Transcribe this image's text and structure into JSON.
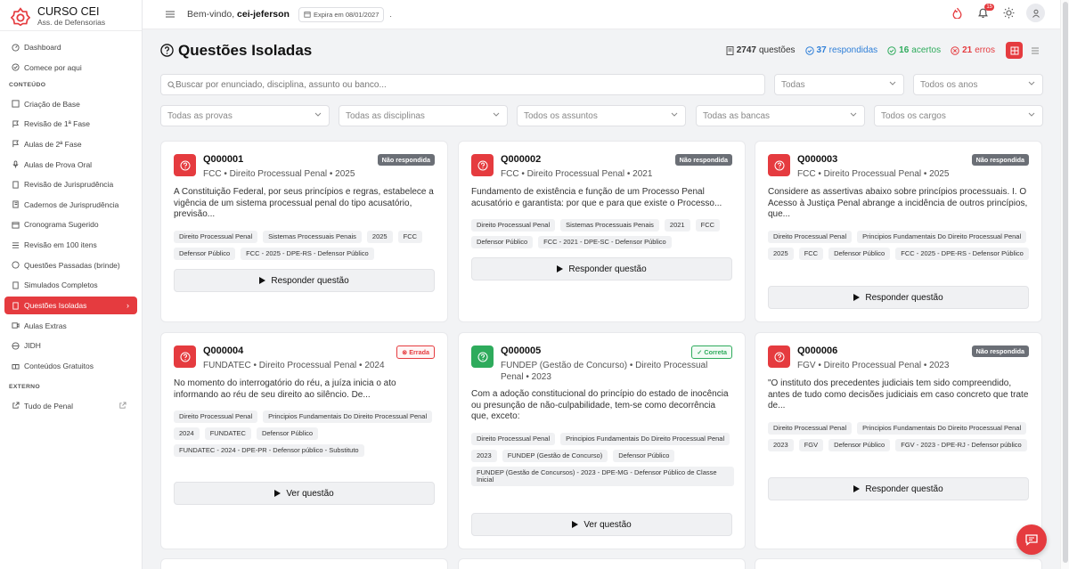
{
  "brand": {
    "name": "CURSO CEI",
    "sub": "Ass. de Defensorias"
  },
  "sidebar": {
    "items": [
      {
        "label": "Dashboard",
        "icon": "dashboard-icon"
      },
      {
        "label": "Comece por aqui",
        "icon": "start-icon"
      }
    ],
    "section_content": "CONTEÚDO",
    "content_items": [
      {
        "label": "Criação de Base",
        "icon": "base-icon"
      },
      {
        "label": "Revisão de 1ª Fase",
        "icon": "flag-icon"
      },
      {
        "label": "Aulas de 2ª Fase",
        "icon": "flag-icon"
      },
      {
        "label": "Aulas de Prova Oral",
        "icon": "mic-icon"
      },
      {
        "label": "Revisão de Jurisprudência",
        "icon": "doc-icon"
      },
      {
        "label": "Cadernos de Jurisprudência",
        "icon": "notebook-icon"
      },
      {
        "label": "Cronograma Sugerido",
        "icon": "calendar-icon"
      },
      {
        "label": "Revisão em 100 itens",
        "icon": "list-icon"
      },
      {
        "label": "Questões Passadas (brinde)",
        "icon": "help-icon"
      },
      {
        "label": "Simulados Completos",
        "icon": "test-icon"
      },
      {
        "label": "Questões Isoladas",
        "icon": "doc-icon",
        "active": true
      },
      {
        "label": "Aulas Extras",
        "icon": "video-icon"
      },
      {
        "label": "JIDH",
        "icon": "globe-icon"
      },
      {
        "label": "Conteúdos Gratuitos",
        "icon": "gift-icon"
      }
    ],
    "section_external": "EXTERNO",
    "external_items": [
      {
        "label": "Tudo de Penal",
        "icon": "link-icon"
      }
    ]
  },
  "topbar": {
    "welcome_prefix": "Bem-vindo, ",
    "username": "cei-jeferson",
    "expira": "Expira em 08/01/2027",
    "dot": ".",
    "notifications": "15"
  },
  "page": {
    "title": "Questões Isoladas",
    "stats": {
      "total": "2747",
      "total_label": "questões",
      "answered": "37",
      "answered_label": "respondidas",
      "correct": "16",
      "correct_label": "acertos",
      "errors": "21",
      "errors_label": "erros"
    }
  },
  "filters": {
    "search_placeholder": "Buscar por enunciado, disciplina, assunto ou banco...",
    "status": "Todas",
    "years": "Todos os anos",
    "exams": "Todas as provas",
    "subjects": "Todas as disciplinas",
    "topics": "Todos os assuntos",
    "boards": "Todas as bancas",
    "positions": "Todos os cargos"
  },
  "cards": [
    {
      "id": "Q000001",
      "meta": "FCC • Direito Processual Penal • 2025",
      "status": "Não respondida",
      "status_type": "nr",
      "icon_color": "red",
      "text": "A Constituição Federal, por seus princípios e regras, estabelece a vigência de um sistema processual penal do tipo acusatório, previsão...",
      "tags": [
        "Direito Processual Penal",
        "Sistemas Processuais Penais",
        "2025",
        "FCC",
        "Defensor Público",
        "FCC - 2025 - DPE-RS - Defensor Público"
      ],
      "button": "Responder questão"
    },
    {
      "id": "Q000002",
      "meta": "FCC • Direito Processual Penal • 2021",
      "status": "Não respondida",
      "status_type": "nr",
      "icon_color": "red",
      "text": "Fundamento de existência e função de um Processo Penal acusatório e garantista: por que e para que existe o Processo...",
      "tags": [
        "Direito Processual Penal",
        "Sistemas Processuais Penais",
        "2021",
        "FCC",
        "Defensor Público",
        "FCC - 2021 - DPE-SC - Defensor Público"
      ],
      "button": "Responder questão"
    },
    {
      "id": "Q000003",
      "meta": "FCC • Direito Processual Penal • 2025",
      "status": "Não respondida",
      "status_type": "nr",
      "icon_color": "red",
      "text": "Considere as assertivas abaixo sobre princípios processuais.   I. O Acesso à Justiça Penal abrange a incidência de outros princípios, que...",
      "tags": [
        "Direito Processual Penal",
        "Principios Fundamentais Do Direito Processual Penal",
        "2025",
        "FCC",
        "Defensor Público",
        "FCC - 2025 - DPE-RS - Defensor Público"
      ],
      "button": "Responder questão"
    },
    {
      "id": "Q000004",
      "meta": "FUNDATEC • Direito Processual Penal • 2024",
      "status": "Errada",
      "status_type": "err",
      "icon_color": "red",
      "text": "No momento do interrogatório do réu, a juíza inicia o ato informando ao réu de seu direito ao silêncio. De...",
      "tags": [
        "Direito Processual Penal",
        "Principios Fundamentais Do Direito Processual Penal",
        "2024",
        "FUNDATEC",
        "Defensor Público",
        "FUNDATEC - 2024 - DPE-PR - Defensor público - Substituto"
      ],
      "button": "Ver questão"
    },
    {
      "id": "Q000005",
      "meta": "FUNDEP (Gestão de Concurso) • Direito Processual Penal • 2023",
      "status": "Correta",
      "status_type": "ok",
      "icon_color": "green",
      "text": "Com a adoção constitucional do princípio do estado de inocência ou presunção de não-culpabilidade, tem-se como decorrência que, exceto:",
      "tags": [
        "Direito Processual Penal",
        "Principios Fundamentais Do Direito Processual Penal",
        "2023",
        "FUNDEP (Gestão de Concurso)",
        "Defensor Público",
        "FUNDEP (Gestão de Concursos) - 2023 - DPE-MG - Defensor Público de Classe Inicial"
      ],
      "button": "Ver questão"
    },
    {
      "id": "Q000006",
      "meta": "FGV • Direito Processual Penal • 2023",
      "status": "Não respondida",
      "status_type": "nr",
      "icon_color": "red",
      "text": "\"O instituto dos precedentes judiciais tem sido compreendido, antes de tudo como decisões judiciais em caso concreto que trate de...",
      "tags": [
        "Direito Processual Penal",
        "Principios Fundamentais Do Direito Processual Penal",
        "2023",
        "FGV",
        "Defensor Público",
        "FGV - 2023 - DPE-RJ - Defensor público"
      ],
      "button": "Responder questão"
    }
  ],
  "colors": {
    "accent": "#e53b3f",
    "correct": "#2eab5c",
    "answered": "#2f7fd8"
  }
}
